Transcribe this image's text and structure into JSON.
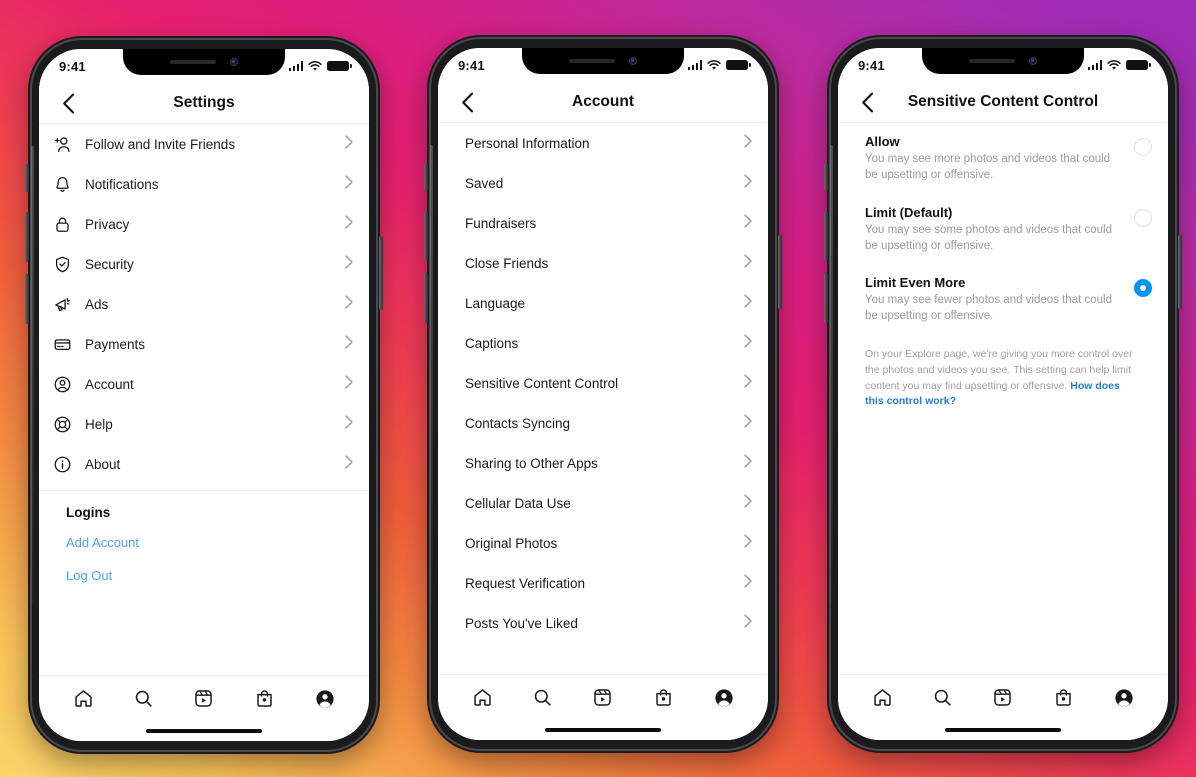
{
  "background": {
    "gradient_colors": [
      "#f9d36a",
      "#f28c42",
      "#ef5c3c",
      "#e61f6e",
      "#bb2b9f",
      "#9b2bb8"
    ]
  },
  "accent": {
    "radio_selected": "#0095f6",
    "link_blue": "#4ea3e8",
    "footnote_link_blue": "#1f7fd6"
  },
  "status_bar": {
    "time": "9:41",
    "signal": "signal-bars",
    "wifi": "wifi",
    "battery": "battery-full"
  },
  "tabbar": {
    "items": [
      {
        "name": "home",
        "label": "Home"
      },
      {
        "name": "search",
        "label": "Search"
      },
      {
        "name": "reels",
        "label": "Reels"
      },
      {
        "name": "shop",
        "label": "Shop"
      },
      {
        "name": "profile",
        "label": "Profile"
      }
    ]
  },
  "phone1": {
    "title": "Settings",
    "back": "back-chevron",
    "items": [
      {
        "icon": "person-plus-icon",
        "label": "Follow and Invite Friends"
      },
      {
        "icon": "bell-icon",
        "label": "Notifications"
      },
      {
        "icon": "lock-icon",
        "label": "Privacy"
      },
      {
        "icon": "shield-check-icon",
        "label": "Security"
      },
      {
        "icon": "megaphone-icon",
        "label": "Ads"
      },
      {
        "icon": "credit-card-icon",
        "label": "Payments"
      },
      {
        "icon": "person-circle-icon",
        "label": "Account"
      },
      {
        "icon": "life-ring-icon",
        "label": "Help"
      },
      {
        "icon": "info-circle-icon",
        "label": "About"
      }
    ],
    "logins_heading": "Logins",
    "add_account": "Add Account",
    "log_out": "Log Out"
  },
  "phone2": {
    "title": "Account",
    "back": "back-chevron",
    "items": [
      {
        "label": "Personal Information"
      },
      {
        "label": "Saved"
      },
      {
        "label": "Fundraisers"
      },
      {
        "label": "Close Friends"
      },
      {
        "label": "Language"
      },
      {
        "label": "Captions"
      },
      {
        "label": "Sensitive Content Control"
      },
      {
        "label": "Contacts Syncing"
      },
      {
        "label": "Sharing to Other Apps"
      },
      {
        "label": "Cellular Data Use"
      },
      {
        "label": "Original Photos"
      },
      {
        "label": "Request Verification"
      },
      {
        "label": "Posts You've Liked"
      }
    ]
  },
  "phone3": {
    "title": "Sensitive Content Control",
    "back": "back-chevron",
    "options": [
      {
        "title": "Allow",
        "desc": "You may see more photos and videos that could be upsetting or offensive.",
        "selected": false
      },
      {
        "title": "Limit (Default)",
        "desc": "You may see some photos and videos that could be upsetting or offensive.",
        "selected": false
      },
      {
        "title": "Limit Even More",
        "desc": "You may see fewer photos and videos that could be upsetting or offensive.",
        "selected": true
      }
    ],
    "footnote_text": "On your Explore page, we're giving you more control over the photos and videos you see. This setting can help limit content you may find upsetting or offensive. ",
    "footnote_link": "How does this control work?"
  }
}
